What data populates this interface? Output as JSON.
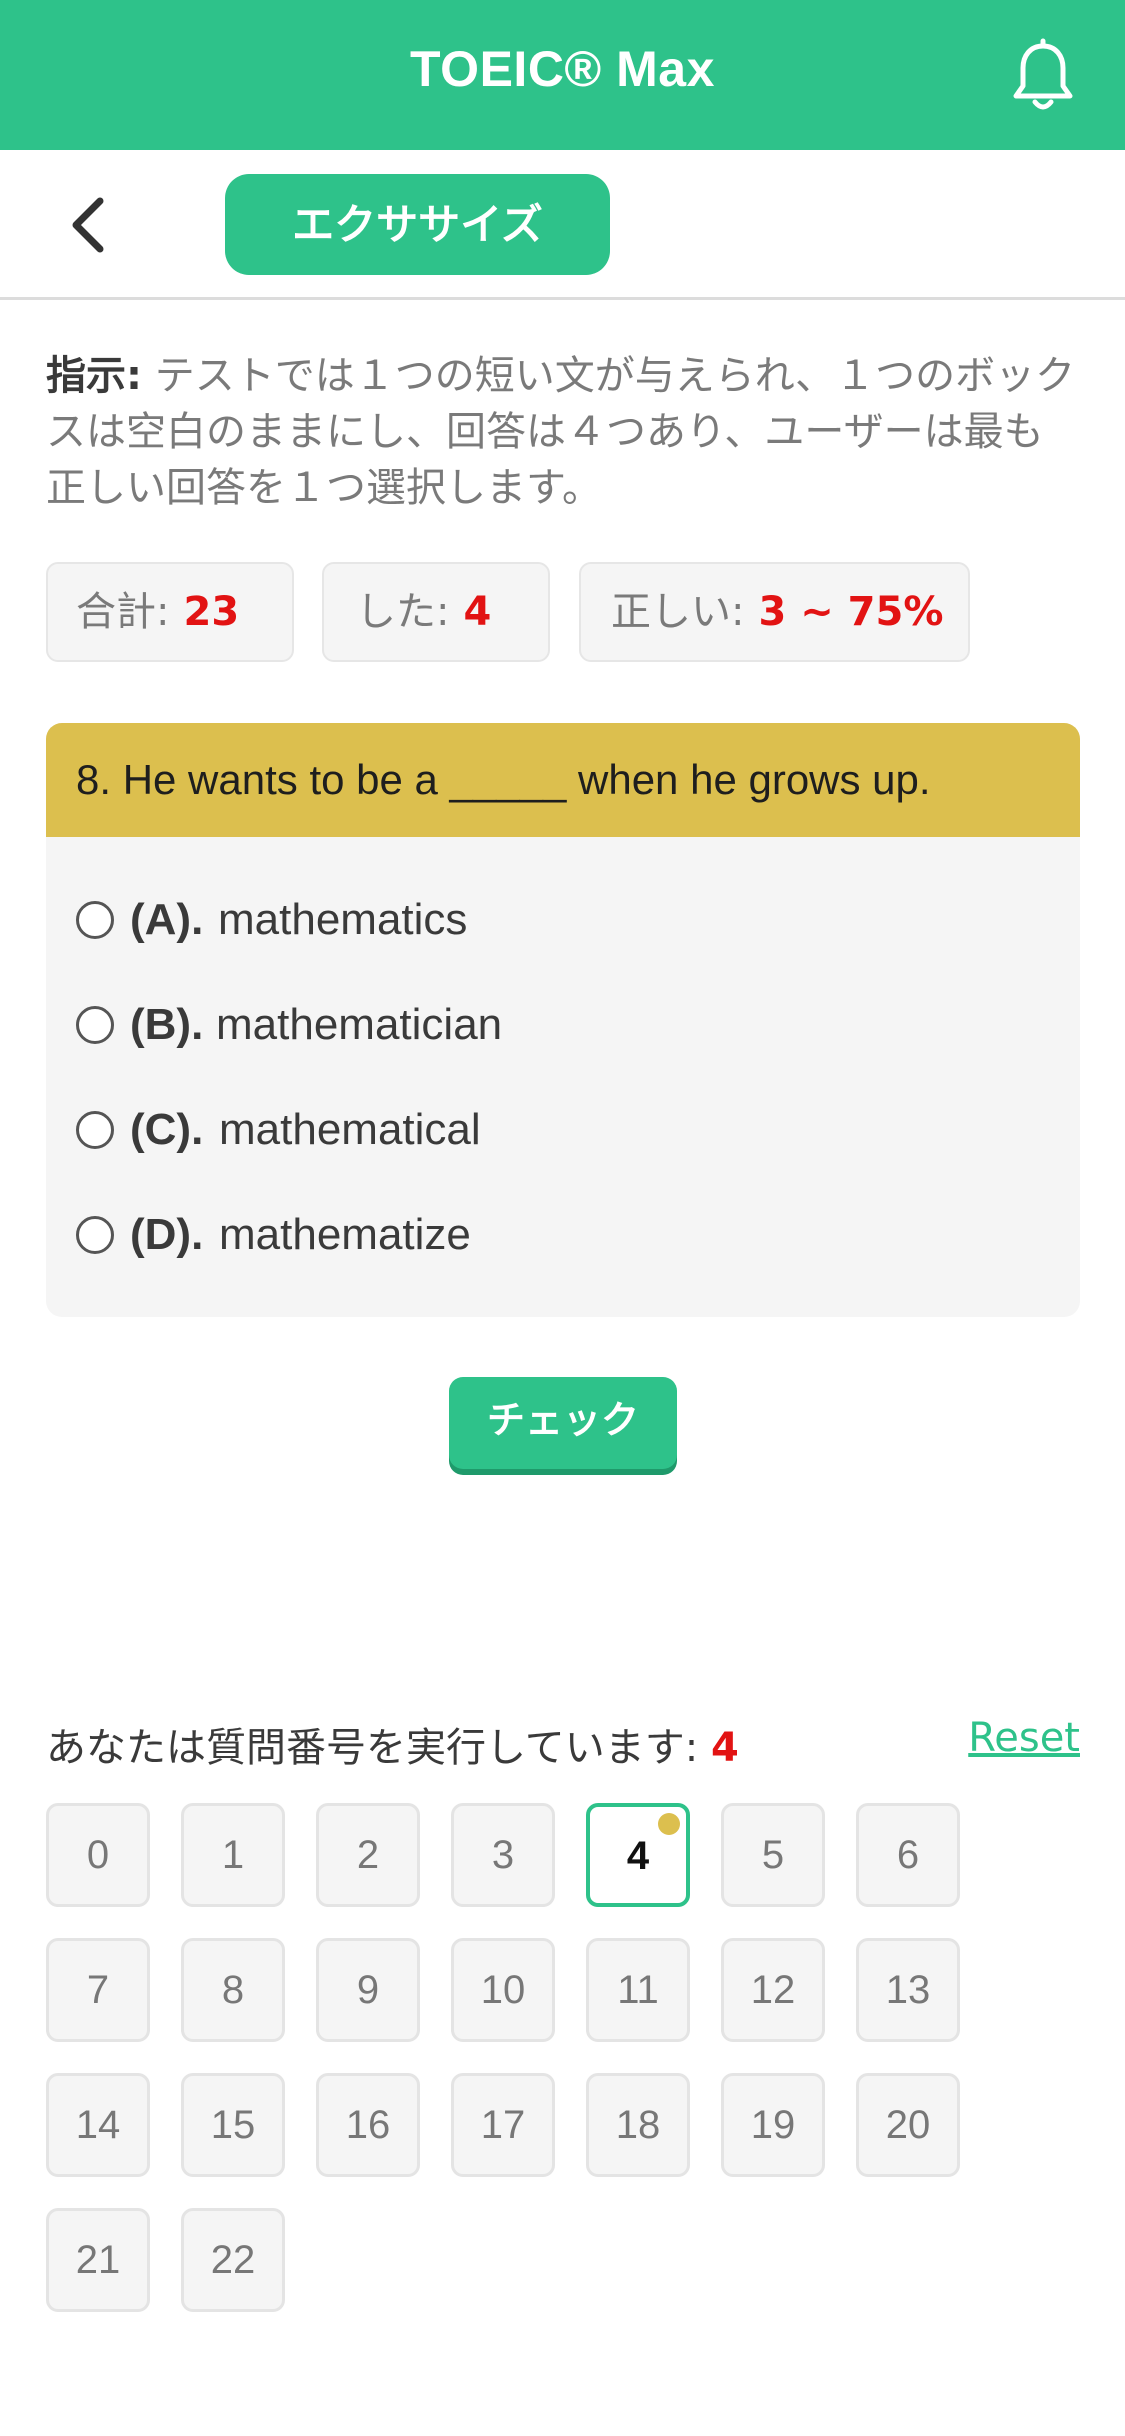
{
  "header": {
    "title": "TOEIC® Max",
    "bell_icon": "bell-icon",
    "accent_color": "#2ec28a"
  },
  "subheader": {
    "back_icon": "chevron-left-icon",
    "tab_label": "エクササイズ"
  },
  "instruction": {
    "label": "指示:",
    "text": " テストでは１つの短い文が与えられ、１つのボックスは空白のままにし、回答は４つあり、ユーザーは最も正しい回答を１つ選択します。"
  },
  "stats": {
    "total_label": "合計:",
    "total_value": "23",
    "done_label": "した:",
    "done_value": "4",
    "correct_label": "正しい:",
    "correct_value": "3 ~ 75%"
  },
  "question": {
    "text": "8. He wants to be a _____ when he grows up.",
    "header_color": "#dcbf4e",
    "options": [
      {
        "letter": "(A).",
        "text": "mathematics"
      },
      {
        "letter": "(B).",
        "text": "mathematician"
      },
      {
        "letter": "(C).",
        "text": "mathematical"
      },
      {
        "letter": "(D).",
        "text": "mathematize"
      }
    ]
  },
  "check_button": "チェック",
  "progress": {
    "label": "あなたは質問番号を実行しています: ",
    "current": "4",
    "reset_label": "Reset"
  },
  "question_numbers": [
    "0",
    "1",
    "2",
    "3",
    "4",
    "5",
    "6",
    "7",
    "8",
    "9",
    "10",
    "11",
    "12",
    "13",
    "14",
    "15",
    "16",
    "17",
    "18",
    "19",
    "20",
    "21",
    "22"
  ],
  "active_question": "4"
}
